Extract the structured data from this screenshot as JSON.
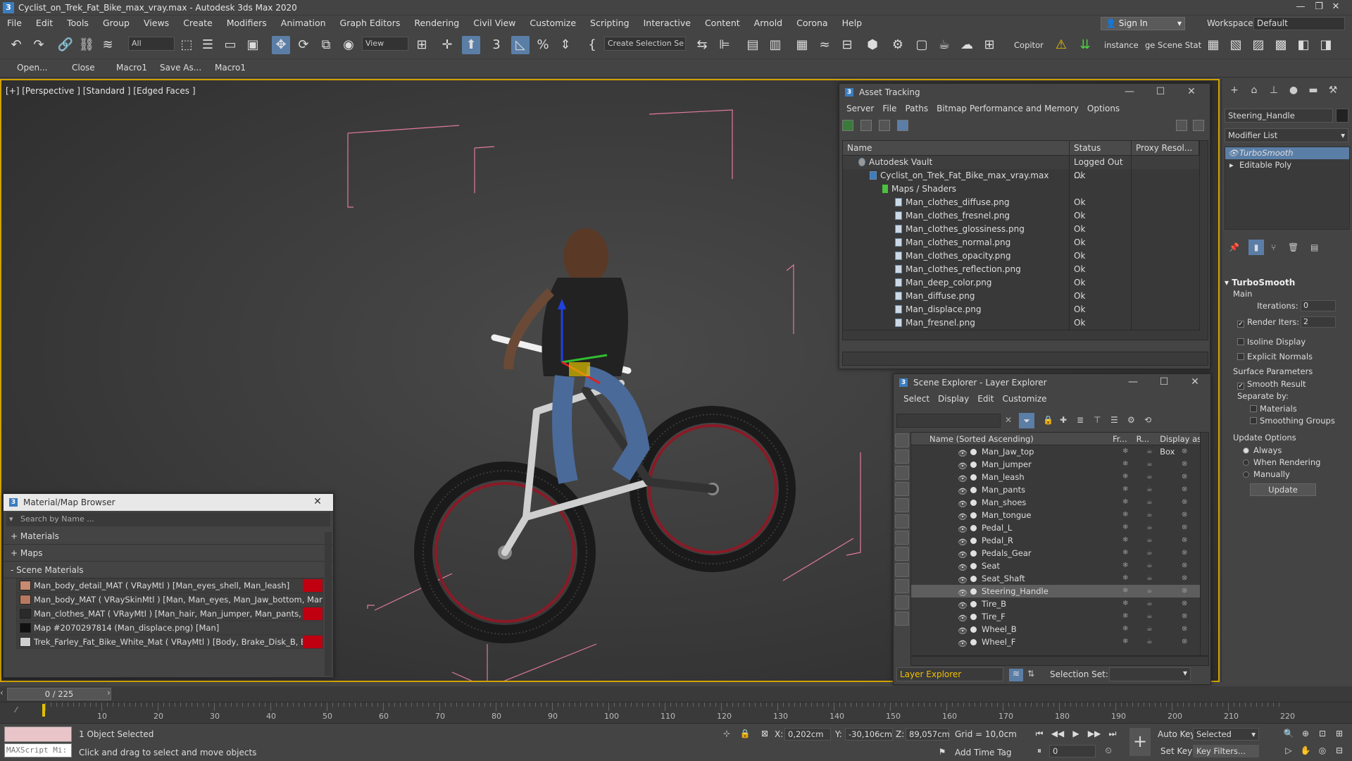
{
  "window": {
    "title": "Cyclist_on_Trek_Fat_Bike_max_vray.max - Autodesk 3ds Max 2020",
    "minimize": "—",
    "restore": "❐",
    "close": "✕"
  },
  "menu": {
    "items": [
      "File",
      "Edit",
      "Tools",
      "Group",
      "Views",
      "Create",
      "Modifiers",
      "Animation",
      "Graph Editors",
      "Rendering",
      "Civil View",
      "Customize",
      "Scripting",
      "Interactive",
      "Content",
      "Arnold",
      "Corona",
      "Help"
    ],
    "sign_in": "Sign In",
    "workspaces_label": "Workspaces:",
    "workspaces_value": "Default"
  },
  "toolbar": {
    "selection_filter": "All",
    "reference_coord": "View",
    "create_selection_set": "Create Selection Se",
    "copitor": "Copitor",
    "instance": "instance",
    "ge_scene_stat": "ge Scene Stat"
  },
  "toolbar2": {
    "items": [
      "Open...",
      "Close",
      "Macro1",
      "Save As...",
      "Macro1"
    ]
  },
  "viewport": {
    "label": "[+] [Perspective ] [Standard ] [Edged Faces ]"
  },
  "asset_tracking": {
    "title": "Asset Tracking",
    "menu": [
      "Server",
      "File",
      "Paths",
      "Bitmap Performance and Memory",
      "Options"
    ],
    "columns": [
      "Name",
      "Status",
      "Proxy Resol..."
    ],
    "rows": [
      {
        "name": "Autodesk Vault",
        "status": "Logged Out ...",
        "indent": 1
      },
      {
        "name": "Cyclist_on_Trek_Fat_Bike_max_vray.max",
        "status": "Ok",
        "indent": 2
      },
      {
        "name": "Maps / Shaders",
        "status": "",
        "indent": 3
      },
      {
        "name": "Man_clothes_diffuse.png",
        "status": "Ok",
        "indent": 4
      },
      {
        "name": "Man_clothes_fresnel.png",
        "status": "Ok",
        "indent": 4
      },
      {
        "name": "Man_clothes_glossiness.png",
        "status": "Ok",
        "indent": 4
      },
      {
        "name": "Man_clothes_normal.png",
        "status": "Ok",
        "indent": 4
      },
      {
        "name": "Man_clothes_opacity.png",
        "status": "Ok",
        "indent": 4
      },
      {
        "name": "Man_clothes_reflection.png",
        "status": "Ok",
        "indent": 4
      },
      {
        "name": "Man_deep_color.png",
        "status": "Ok",
        "indent": 4
      },
      {
        "name": "Man_diffuse.png",
        "status": "Ok",
        "indent": 4
      },
      {
        "name": "Man_displace.png",
        "status": "Ok",
        "indent": 4
      },
      {
        "name": "Man_fresnel.png",
        "status": "Ok",
        "indent": 4
      }
    ]
  },
  "scene_explorer": {
    "title": "Scene Explorer - Layer Explorer",
    "menu": [
      "Select",
      "Display",
      "Edit",
      "Customize"
    ],
    "columns": [
      "Name (Sorted Ascending)",
      "Fr...",
      "R...",
      "Display as Box"
    ],
    "rows": [
      "Man_Jaw_top",
      "Man_jumper",
      "Man_leash",
      "Man_pants",
      "Man_shoes",
      "Man_tongue",
      "Pedal_L",
      "Pedal_R",
      "Pedals_Gear",
      "Seat",
      "Seat_Shaft",
      "Steering_Handle",
      "Tire_B",
      "Tire_F",
      "Wheel_B",
      "Wheel_F"
    ],
    "selected": "Steering_Handle",
    "footer_mode": "Layer Explorer",
    "selection_set_label": "Selection Set:"
  },
  "material_browser": {
    "title": "Material/Map Browser",
    "search_placeholder": "Search by Name ...",
    "sections": [
      "+ Materials",
      "+ Maps",
      "- Scene Materials"
    ],
    "materials": [
      {
        "label": "Man_body_detail_MAT ( VRayMtl ) [Man_eyes_shell, Man_leash]",
        "swatch": "#c88a70",
        "flag": true
      },
      {
        "label": "Man_body_MAT ( VRaySkinMtl ) [Man, Man_eyes, Man_Jaw_bottom, Man_Ja...",
        "swatch": "#b87860",
        "flag": false
      },
      {
        "label": "Man_clothes_MAT ( VRayMtl ) [Man_hair, Man_jumper, Man_pants, Man_shoe...",
        "swatch": "#2a2a2a",
        "flag": true
      },
      {
        "label": "Map #2070297814 (Man_displace.png) [Man]",
        "swatch": "#111111",
        "flag": false
      },
      {
        "label": "Trek_Farley_Fat_Bike_White_Mat ( VRayMtl ) [Body, Brake_Disk_B, Brake_Dis...",
        "swatch": "#d0d0d0",
        "flag": true
      }
    ]
  },
  "command_panel": {
    "object_name": "Steering_Handle",
    "modifier_list": "Modifier List",
    "stack": [
      "TurboSmooth",
      "Editable Poly"
    ],
    "rollout_title": "TurboSmooth",
    "main_label": "Main",
    "iterations_label": "Iterations:",
    "iterations_value": "0",
    "render_iters_label": "Render Iters:",
    "render_iters_value": "2",
    "isoline": "Isoline Display",
    "explicit_normals": "Explicit Normals",
    "surface_params": "Surface Parameters",
    "smooth_result": "Smooth Result",
    "separate_by": "Separate by:",
    "materials": "Materials",
    "smoothing_groups": "Smoothing Groups",
    "update_options": "Update Options",
    "always": "Always",
    "when_rendering": "When Rendering",
    "manually": "Manually",
    "update_button": "Update"
  },
  "timeline": {
    "frame": "0 / 225",
    "ticks": [
      "10",
      "20",
      "30",
      "40",
      "50",
      "60",
      "70",
      "80",
      "90",
      "100",
      "110",
      "120",
      "130",
      "140",
      "150",
      "160",
      "170",
      "180",
      "190",
      "200",
      "210",
      "220"
    ]
  },
  "status": {
    "maxscript": "MAXScript Mi:",
    "selected": "1 Object Selected",
    "prompt": "Click and drag to select and move objects",
    "x_label": "X:",
    "x_value": "0,202cm",
    "y_label": "Y:",
    "y_value": "-30,106cm",
    "z_label": "Z:",
    "z_value": "89,057cm",
    "grid": "Grid = 10,0cm",
    "add_time_tag": "Add Time Tag",
    "auto_key": "Auto Key",
    "set_key": "Set Key",
    "selected_dropdown": "Selected",
    "key_filters": "Key Filters...",
    "frame_field": "0"
  },
  "colors": {
    "accent": "#5b7ea7",
    "viewport_border": "#d1a300",
    "bbox": "#e07aa0"
  }
}
